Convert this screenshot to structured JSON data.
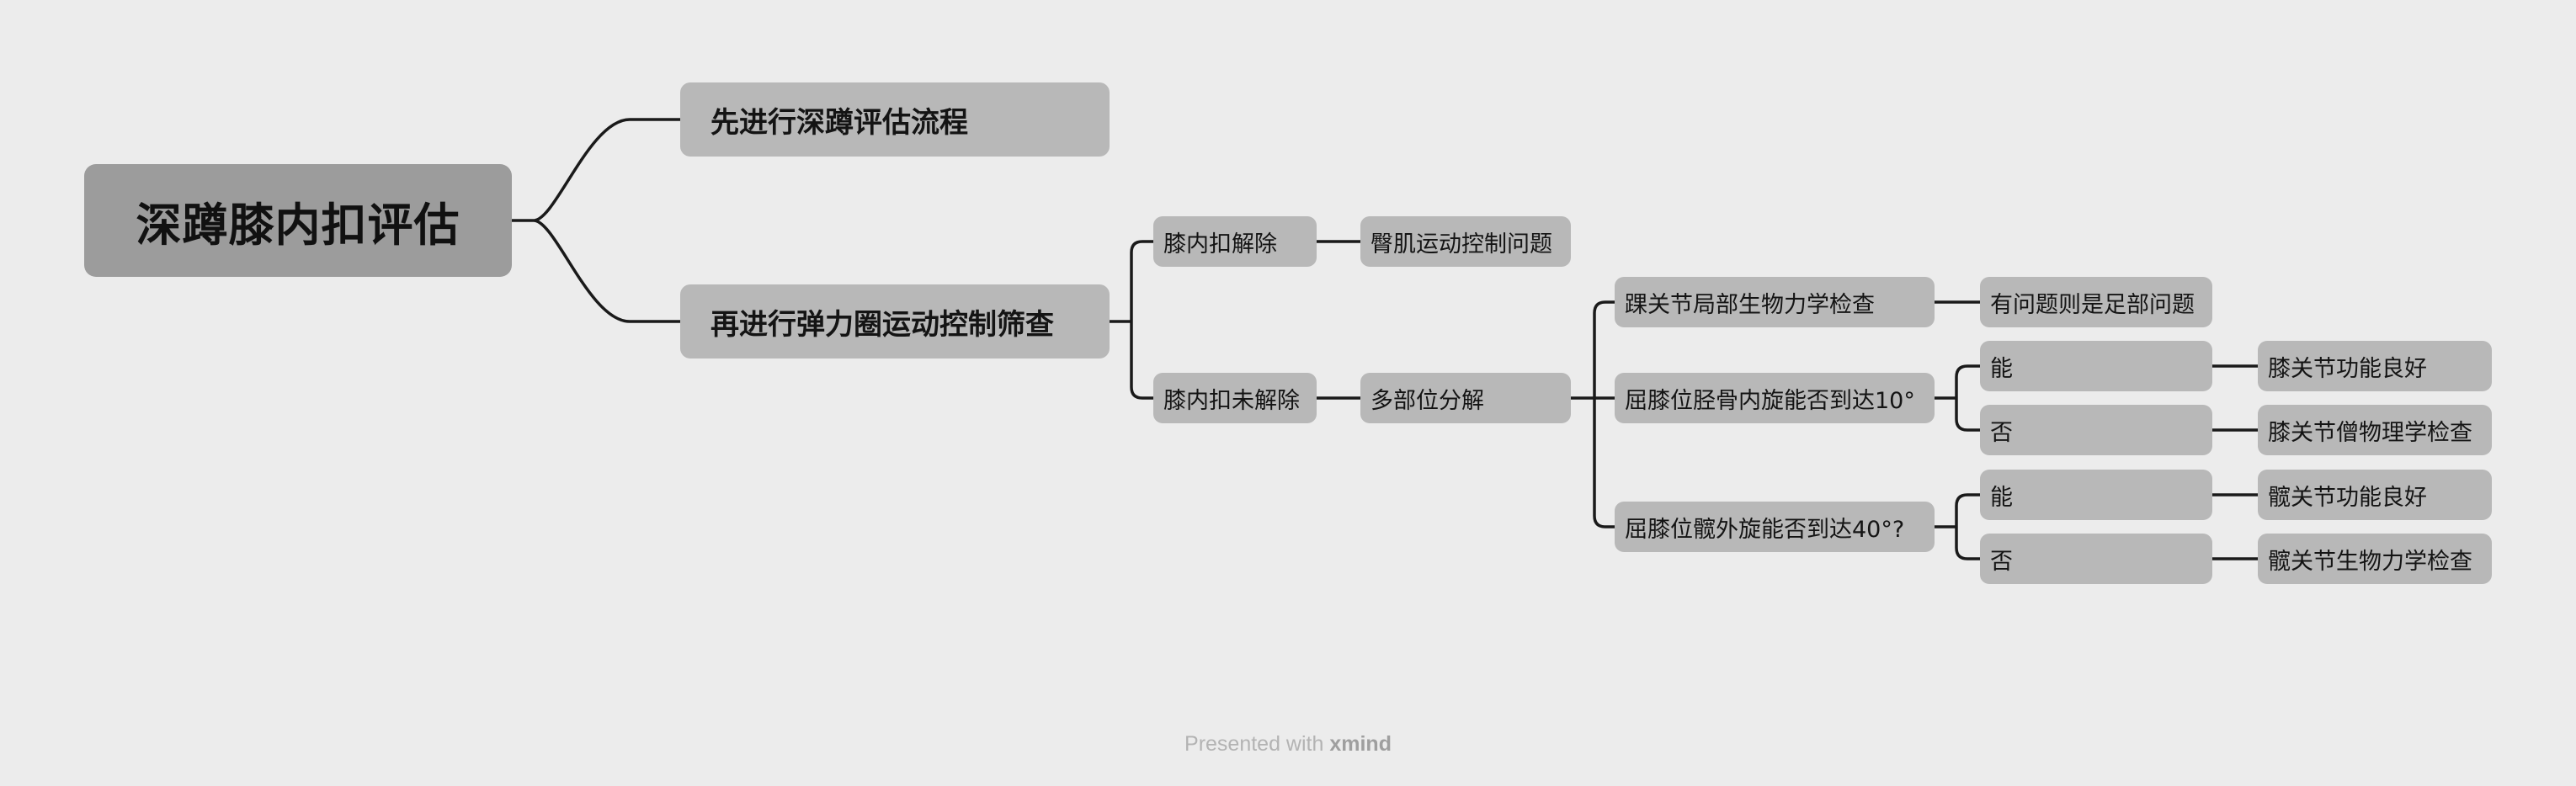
{
  "mindmap": {
    "root": "深蹲膝内扣评估",
    "branch_deep_squat": "先进行深蹲评估流程",
    "branch_band_screen": "再进行弹力圈运动控制筛查",
    "knee_in_resolved": "膝内扣解除",
    "glute_motor_control": "臀肌运动控制问题",
    "knee_in_unresolved": "膝内扣未解除",
    "multi_segment": "多部位分解",
    "ankle_biomech_check": "踝关节局部生物力学检查",
    "foot_problem_note": "有问题则是足部问题",
    "tibial_rotation_question": "屈膝位胫骨内旋能否到达10°",
    "tibial_yes": "能",
    "knee_function_good": "膝关节功能良好",
    "tibial_no": "否",
    "knee_biomech_check": "膝关节僧物理学检查",
    "hip_rotation_question": "屈膝位髋外旋能否到达40°?",
    "hip_yes": "能",
    "hip_function_good": "髋关节功能良好",
    "hip_no": "否",
    "hip_biomech_check": "髋关节生物力学检查"
  },
  "footer": {
    "prefix": "Presented with",
    "brand": "xmind"
  },
  "colors": {
    "background": "#ececec",
    "root_fill": "#9c9c9c",
    "node_fill": "#b8b8b8",
    "connector": "#1a1a1a",
    "footer_text": "#b3b3b3"
  }
}
